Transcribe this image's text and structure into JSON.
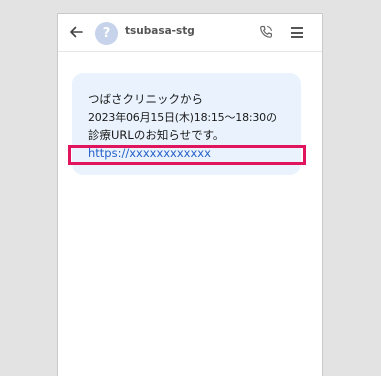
{
  "header": {
    "back_icon": "arrow-left-icon",
    "avatar_glyph": "?",
    "contact_name": "tsubasa-stg",
    "call_icon": "phone-icon",
    "menu_icon": "hamburger-menu-icon"
  },
  "message": {
    "line1": "つばさクリニックから",
    "line2": "2023年06月15日(木)18:15〜18:30の",
    "line3": "診療URLのお知らせです。",
    "link": "https://xxxxxxxxxxxx"
  },
  "colors": {
    "bubble": "#eaf3fd",
    "link": "#2561c9",
    "highlight": "#e1155d",
    "avatar": "#c7d3ea"
  }
}
